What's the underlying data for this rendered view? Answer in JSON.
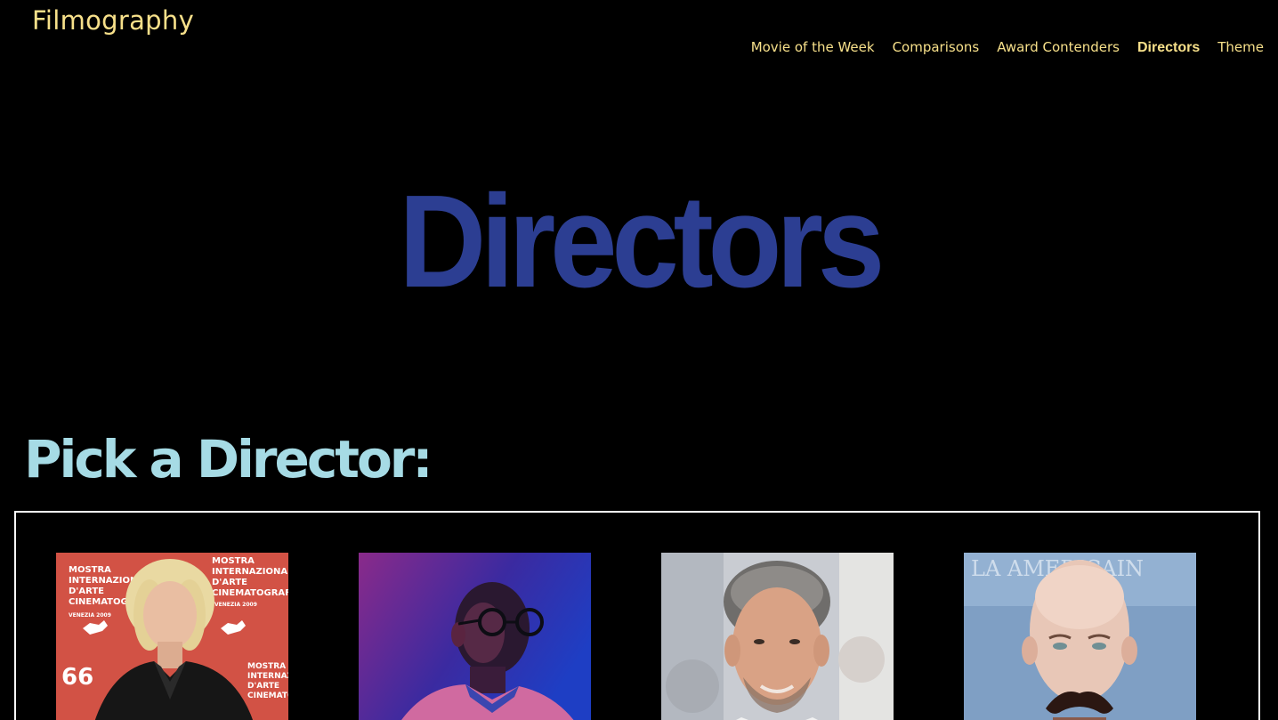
{
  "header": {
    "site_title": "Filmography",
    "nav": [
      {
        "label": "Movie of the Week",
        "active": false
      },
      {
        "label": "Comparisons",
        "active": false
      },
      {
        "label": "Award Contenders",
        "active": false
      },
      {
        "label": "Directors",
        "active": true
      },
      {
        "label": "Theme",
        "active": false
      }
    ]
  },
  "hero": {
    "heading": "Directors"
  },
  "picker": {
    "heading": "Pick a Director:",
    "photos": [
      {
        "backdrop_lines": [
          "MOSTRA",
          "INTERNAZIONALE",
          "D'ARTE",
          "CINEMATOGRAFICA",
          "VENEZIA 2009"
        ],
        "backdrop_number": "66"
      },
      {
        "backdrop_lines": [],
        "backdrop_number": ""
      },
      {
        "backdrop_lines": [],
        "backdrop_number": ""
      },
      {
        "backdrop_lines": [
          "LA AMERICAIN"
        ],
        "backdrop_number": ""
      }
    ]
  },
  "colors": {
    "background": "#000000",
    "nav_text": "#f7e08a",
    "hero_heading": "#2c3e92",
    "section_heading": "#a6dbe5",
    "gallery_border": "#ffffff"
  }
}
